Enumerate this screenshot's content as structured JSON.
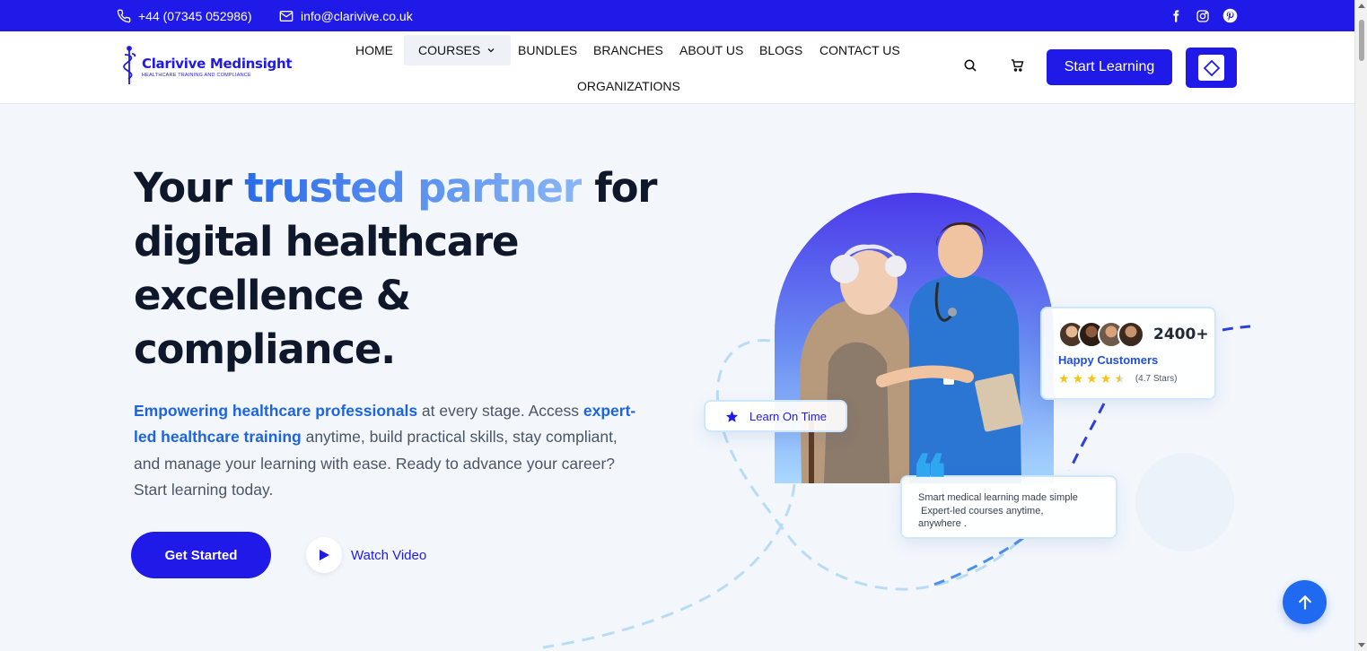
{
  "topbar": {
    "phone": "+44 (07345 052986)",
    "email": "info@clarivive.co.uk",
    "social_icons": [
      "facebook-icon",
      "instagram-icon",
      "pinterest-icon"
    ]
  },
  "header": {
    "logo_name": "Clarivive Medinsight",
    "logo_tagline": "HEALTHCARE TRAINING AND COMPLIANCE",
    "nav": {
      "home": "HOME",
      "courses": "COURSES",
      "bundles": "BUNDLES",
      "branches": "BRANCHES",
      "about": "ABOUT US",
      "blogs": "BLOGS",
      "contact": "CONTACT US",
      "organizations": "ORGANIZATIONS"
    },
    "cta_label": "Start Learning"
  },
  "hero": {
    "title_1": "Your ",
    "title_highlight": "trusted partner",
    "title_2": " for digital healthcare excellence & compliance.",
    "desc_em_1": "Empowering healthcare professionals",
    "desc_1": " at every stage. Access ",
    "desc_em_2": "expert-led healthcare training",
    "desc_2": " anytime, build practical skills, stay compliant, and manage your learning with ease. Ready to advance your career? Start learning today.",
    "get_started": "Get Started",
    "watch_video": "Watch Video"
  },
  "badges": {
    "learn_on_time": "Learn On Time",
    "customer_count": "2400+",
    "customer_label": "Happy Customers",
    "rating": "(4.7 Stars)",
    "rating_value": 4.7,
    "quote_line_1": "Smart medical learning made simple",
    "quote_line_2": " Expert-led courses anytime,",
    "quote_line_3": "anywhere ."
  },
  "colors": {
    "brand": "#1f1ae8",
    "highlight": "#1d64e0",
    "star": "#f6c416",
    "background": "#f3f7fc"
  }
}
